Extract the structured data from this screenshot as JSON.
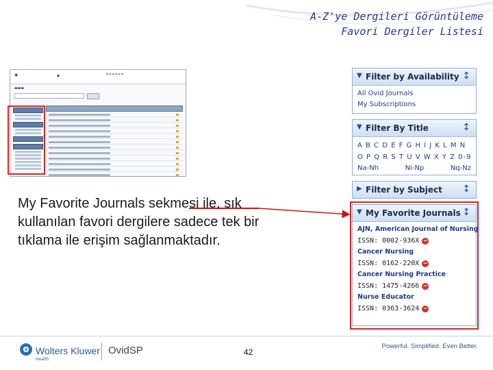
{
  "slide": {
    "title_line1": "A-Z'ye Dergileri Görüntüleme",
    "title_line2": "Favori Dergiler Listesi",
    "description": "My Favorite Journals sekmesi ile, sık kullanılan favori dergilere sadece tek bir tıklama ile erişim sağlanmaktadır.",
    "page_number": "42"
  },
  "panels": {
    "availability": {
      "header": "Filter by Availability",
      "items": [
        "All Ovid Journals",
        "My Subscriptions"
      ]
    },
    "title": {
      "header": "Filter By Title",
      "letters_row1": "A B C D E F G H I J K L M N",
      "letters_row2": "O P Q R S T U V W X Y Z 0-9",
      "ranges": [
        "Na-Nh",
        "Ni-Np",
        "Nq-Nz"
      ]
    },
    "subject": {
      "header": "Filter by Subject"
    },
    "favorites": {
      "header": "My Favorite Journals",
      "journals": [
        {
          "name": "AJN, American Journal of Nursing",
          "issn": "ISSN: 0002-936X"
        },
        {
          "name": "Cancer Nursing",
          "issn": "ISSN: 0162-220X"
        },
        {
          "name": "Cancer Nursing Practice",
          "issn": "ISSN: 1475-4266"
        },
        {
          "name": "Nurse Educator",
          "issn": "ISSN: 0363-3624"
        }
      ]
    }
  },
  "footer": {
    "brand": "Wolters Kluwer",
    "brand_sub": "Health",
    "product": "OvidSP",
    "tagline": "Powerful. Simplified. Even Better."
  },
  "colors": {
    "accent_blue": "#1f3b8c",
    "highlight_red": "#d22222",
    "panel_border": "#8fb0d8"
  }
}
